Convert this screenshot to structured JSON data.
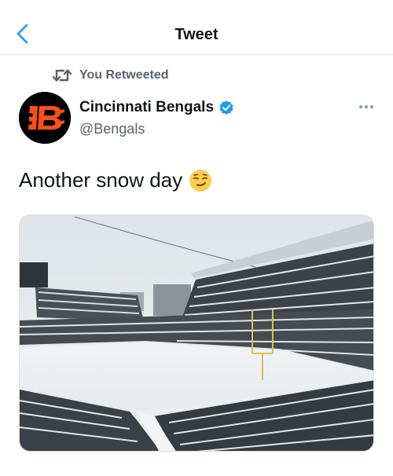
{
  "header": {
    "title": "Tweet",
    "back_icon": "chevron-left-icon"
  },
  "retweet": {
    "label": "You Retweeted",
    "icon": "retweet-icon"
  },
  "author": {
    "name": "Cincinnati Bengals",
    "handle": "@Bengals",
    "verified": true,
    "avatar_logo": "bengals-b-logo"
  },
  "tweet": {
    "text": "Another snow day",
    "emoji": "smirking-face-emoji",
    "media_description_icon": "snowy-stadium-photo"
  },
  "colors": {
    "accent": "#1d9bf0",
    "secondary_text": "#536471",
    "bengals_orange": "#fb4f14"
  }
}
